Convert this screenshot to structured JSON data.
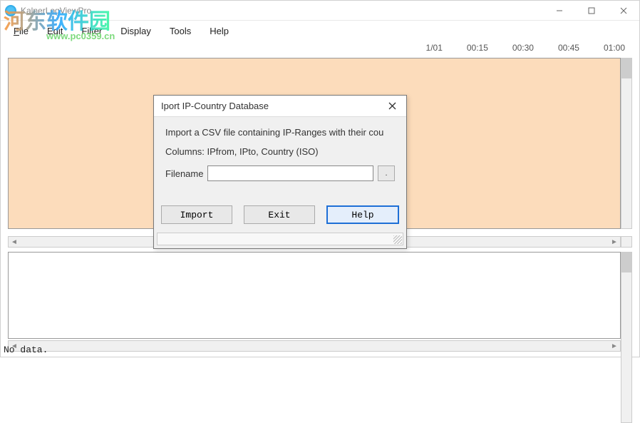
{
  "window": {
    "title": "KalnerLogViewPro",
    "controls": {
      "min": "–",
      "max": "▢",
      "close": "✕"
    }
  },
  "menu": {
    "file": "File",
    "edit": "Edit",
    "filter": "Filter",
    "display": "Display",
    "tools": "Tools",
    "help": "Help"
  },
  "timeline": [
    "1/01",
    "00:15",
    "00:30",
    "00:45",
    "01:00"
  ],
  "status_text": "No data.",
  "watermark": {
    "line1": "河东软件园",
    "line2": "www.pc0359.cn"
  },
  "dialog": {
    "title": "Iport IP-Country Database",
    "desc": "Import a CSV file containing IP-Ranges with their cou",
    "columns": "Columns:  IPfrom, IPto, Country (ISO)",
    "filename_label": "Filename",
    "filename_value": "",
    "browse_label": ".",
    "buttons": {
      "import": "Import",
      "exit": "Exit",
      "help": "Help"
    }
  }
}
